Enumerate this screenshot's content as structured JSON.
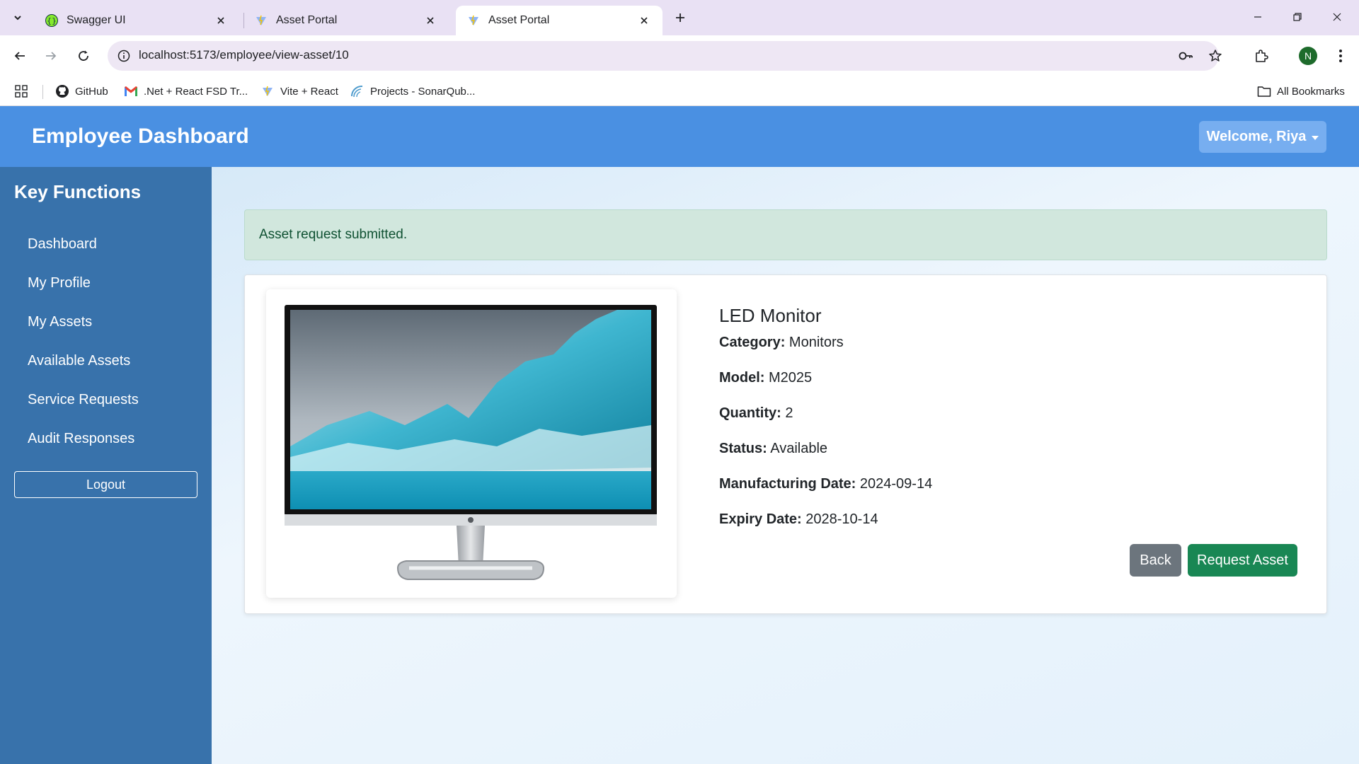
{
  "browser": {
    "tabs": [
      {
        "title": "Swagger UI",
        "icon": "swagger-icon"
      },
      {
        "title": "Asset Portal",
        "icon": "vite-icon"
      },
      {
        "title": "Asset Portal",
        "icon": "vite-icon",
        "active": true
      }
    ],
    "url": "localhost:5173/employee/view-asset/10",
    "profile_initial": "N",
    "bookmarks": [
      {
        "label": "GitHub",
        "icon": "github-icon"
      },
      {
        "label": ".Net + React FSD Tr...",
        "icon": "gmail-icon"
      },
      {
        "label": "Vite + React",
        "icon": "vite-icon"
      },
      {
        "label": "Projects - SonarQub...",
        "icon": "sonarqube-icon"
      }
    ],
    "all_bookmarks": "All Bookmarks"
  },
  "header": {
    "title": "Employee Dashboard",
    "welcome": "Welcome, Riya"
  },
  "sidebar": {
    "heading": "Key Functions",
    "items": [
      {
        "label": "Dashboard"
      },
      {
        "label": "My Profile"
      },
      {
        "label": "My Assets"
      },
      {
        "label": "Available Assets"
      },
      {
        "label": "Service Requests"
      },
      {
        "label": "Audit Responses"
      }
    ],
    "logout": "Logout"
  },
  "alert": {
    "message": "Asset request submitted."
  },
  "asset": {
    "name": "LED Monitor",
    "fields": [
      {
        "label": "Category:",
        "value": "Monitors"
      },
      {
        "label": "Model:",
        "value": "M2025"
      },
      {
        "label": "Quantity:",
        "value": "2"
      },
      {
        "label": "Status:",
        "value": "Available"
      },
      {
        "label": "Manufacturing Date:",
        "value": "2024-09-14"
      },
      {
        "label": "Expiry Date:",
        "value": "2028-10-14"
      }
    ],
    "image": "led-monitor-image"
  },
  "actions": {
    "back": "Back",
    "request": "Request Asset"
  },
  "colors": {
    "header": "#4a90e2",
    "sidebar": "#3872ab",
    "success": "#198754",
    "secondary": "#6c757d",
    "alert_bg": "#d1e7dd"
  }
}
